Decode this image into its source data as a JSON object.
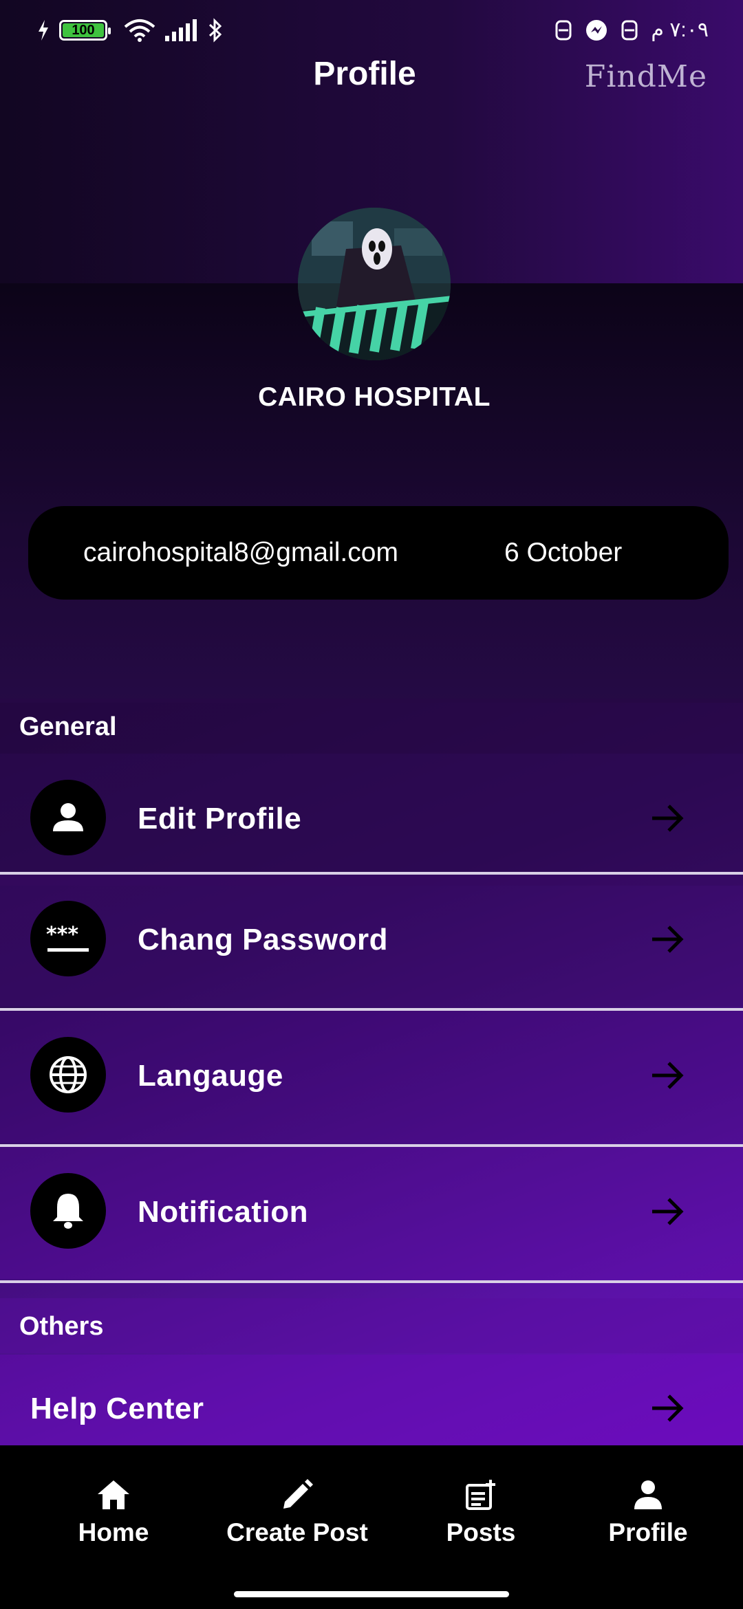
{
  "status_bar": {
    "battery_level": "100",
    "time": "٧:٠٩ م"
  },
  "header": {
    "title": "Profile",
    "brand_logo": "FindMe"
  },
  "profile": {
    "name": "CAIRO HOSPITAL",
    "email": "cairohospital8@gmail.com",
    "location": "6 October"
  },
  "sections": {
    "general": {
      "title": "General",
      "items": [
        {
          "label": "Edit Profile",
          "icon": "person-icon"
        },
        {
          "label": "Chang Password",
          "icon": "password-icon"
        },
        {
          "label": "Langauge",
          "icon": "globe-icon"
        },
        {
          "label": "Notification",
          "icon": "bell-icon"
        }
      ]
    },
    "others": {
      "title": "Others",
      "items": [
        {
          "label": "Help Center",
          "icon": "arrow-right-icon"
        }
      ]
    }
  },
  "bottom_nav": {
    "items": [
      {
        "label": "Home",
        "icon": "home-icon"
      },
      {
        "label": "Create Post",
        "icon": "pencil-icon"
      },
      {
        "label": "Posts",
        "icon": "post-add-icon"
      },
      {
        "label": "Profile",
        "icon": "person-icon"
      }
    ]
  },
  "colors": {
    "accent_purple": "#7a0ccf",
    "dark_purple": "#1a0733",
    "pill_background": "#000000",
    "battery_green": "#3fc33f"
  }
}
